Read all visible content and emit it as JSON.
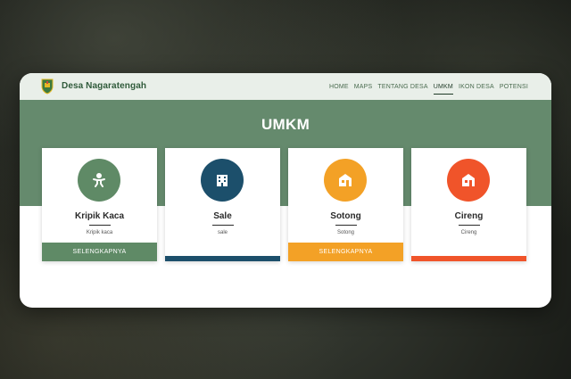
{
  "header": {
    "brand": "Desa Nagaratengah",
    "nav": [
      "HOME",
      "MAPS",
      "TENTANG DESA",
      "UMKM",
      "IKON DESA",
      "POTENSI"
    ],
    "active_nav": "UMKM"
  },
  "hero": {
    "title": "UMKM"
  },
  "cards": [
    {
      "title": "Kripik Kaca",
      "subtitle": "Kripik kaca",
      "button": "SELENGKAPNYA",
      "color": "#5f8a66",
      "icon": "baby-icon"
    },
    {
      "title": "Sale",
      "subtitle": "sale",
      "button": "",
      "color": "#1c4f6b",
      "icon": "building-icon"
    },
    {
      "title": "Sotong",
      "subtitle": "Sotong",
      "button": "SELENGKAPNYA",
      "color": "#f3a126",
      "icon": "shop-icon"
    },
    {
      "title": "Cireng",
      "subtitle": "Cireng",
      "button": "",
      "color": "#f0542a",
      "icon": "shop-icon"
    }
  ],
  "colors": {
    "hero": "#658a6d",
    "navbar": "#e9efe9",
    "brand": "#2f5a3a"
  }
}
